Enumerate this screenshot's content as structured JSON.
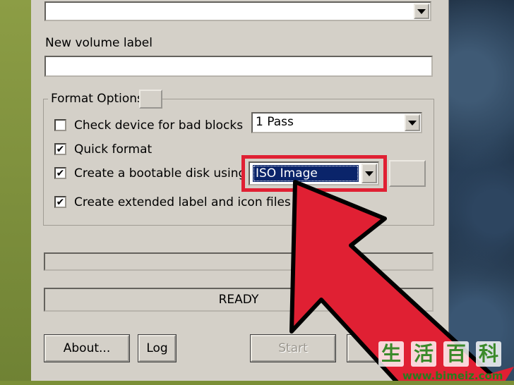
{
  "dialog": {
    "volume_label_caption": "New volume label",
    "volume_label_value": "",
    "format_options_title": "Format Options",
    "check_bad_blocks_label": "Check device for bad blocks",
    "check_bad_blocks_checked": false,
    "passes_value": "1 Pass",
    "quick_format_label": "Quick format",
    "quick_format_checked": true,
    "bootable_label": "Create a bootable disk using",
    "bootable_checked": true,
    "boot_source_value": "ISO Image",
    "extended_label_label": "Create extended label and icon files",
    "extended_label_checked": true,
    "progress_value": 0,
    "status_text": "READY"
  },
  "buttons": {
    "about": "About...",
    "log": "Log",
    "start": "Start"
  },
  "checkmark": "✔",
  "watermark": {
    "chars": [
      "生",
      "活",
      "百",
      "科"
    ],
    "url": "www.bimeiz.com"
  },
  "colors": {
    "highlight": "#e02033",
    "selection": "#0a246a",
    "dialog_bg": "#d4d0c8"
  }
}
